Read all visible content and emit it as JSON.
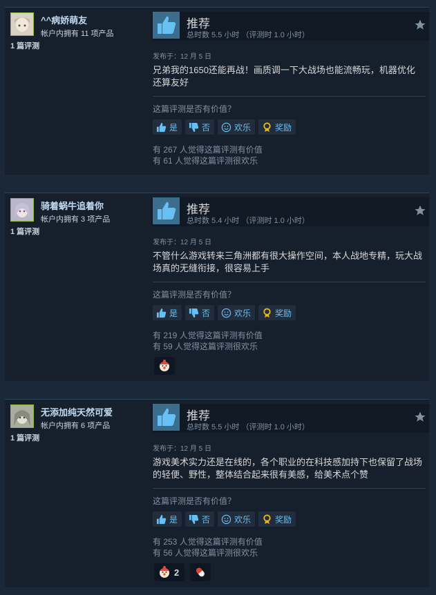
{
  "reviews": [
    {
      "author": "^^病娇萌友",
      "owned": "帐户内拥有 11 项产品",
      "review_count": "1 篇评测",
      "recommendation": "推荐",
      "hours": "总时数 5.5 小时 （评测时 1.0 小时）",
      "posted": "发布于：12 月 5 日",
      "text_lines": [
        "兄弟我的1650还能再战！画质调一下大战场也能流畅玩，机器优化",
        "还算友好"
      ],
      "helpful_question": "这篇评测是否有价值？",
      "btn_yes": "是",
      "btn_no": "否",
      "btn_funny": "欢乐",
      "btn_award": "奖励",
      "helpful_count": "有 267 人觉得这篇评测有价值",
      "funny_count": "有 61 人觉得这篇评测很欢乐",
      "awards": []
    },
    {
      "author": "骑着蜗牛追着你",
      "owned": "帐户内拥有 3 项产品",
      "review_count": "1 篇评测",
      "recommendation": "推荐",
      "hours": "总时数 5.4 小时 （评测时 1.0 小时）",
      "posted": "发布于：12 月 5 日",
      "text_lines": [
        "不管什么游戏转来三角洲都有很大操作空间，本人战地专精，玩大战",
        "场真的无缝衔接，很容易上手"
      ],
      "helpful_question": "这篇评测是否有价值？",
      "btn_yes": "是",
      "btn_no": "否",
      "btn_funny": "欢乐",
      "btn_award": "奖励",
      "helpful_count": "有 219 人觉得这篇评测有价值",
      "funny_count": "有 59 人觉得这篇评测很欢乐",
      "awards": [
        {
          "icon": "clown-face-award-icon",
          "count": ""
        }
      ]
    },
    {
      "author": "无添加纯天然可爱",
      "owned": "帐户内拥有 6 项产品",
      "review_count": "1 篇评测",
      "recommendation": "推荐",
      "hours": "总时数 5.5 小时 （评测时 1.0 小时）",
      "posted": "发布于：12 月 5 日",
      "text_lines": [
        "游戏美术实力还是在线的，各个职业的在科技感加持下也保留了战场",
        "的轻便、野性，整体结合起来很有美感，给美术点个赞"
      ],
      "helpful_question": "这篇评测是否有价值？",
      "btn_yes": "是",
      "btn_no": "否",
      "btn_funny": "欢乐",
      "btn_award": "奖励",
      "helpful_count": "有 253 人觉得这篇评测有价值",
      "funny_count": "有 56 人觉得这篇评测很欢乐",
      "awards": [
        {
          "icon": "clown-face-award-icon",
          "count": "2"
        },
        {
          "icon": "pill-capsule-award-icon",
          "count": ""
        }
      ]
    }
  ],
  "colors": {
    "background": "#1b2838",
    "card": "#16202d",
    "link": "#66c0f4",
    "thumb": "#3b6e8c"
  }
}
